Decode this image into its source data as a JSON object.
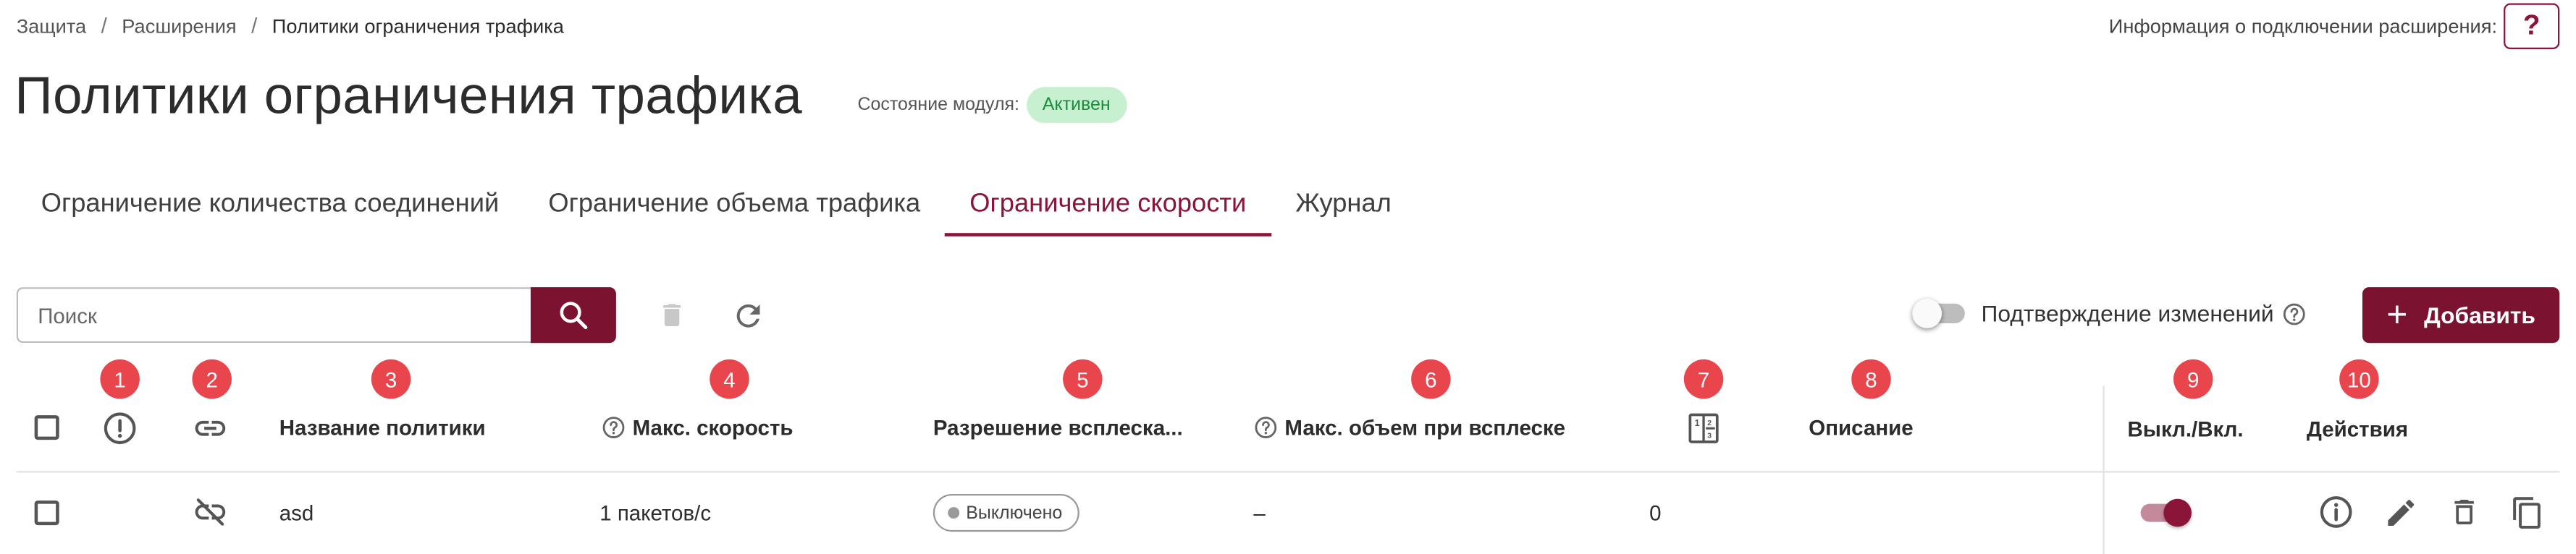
{
  "breadcrumb": {
    "items": [
      "Защита",
      "Расширения"
    ],
    "current": "Политики ограничения трафика",
    "separator": "/"
  },
  "header": {
    "connection_info_label": "Информация о подключении расширения:",
    "help_label": "?",
    "title": "Политики ограничения трафика",
    "module_state_label": "Состояние модуля:",
    "module_state_value": "Активен"
  },
  "tabs": [
    {
      "label": "Ограничение количества соединений",
      "active": false
    },
    {
      "label": "Ограничение объема трафика",
      "active": false
    },
    {
      "label": "Ограничение скорости",
      "active": true
    },
    {
      "label": "Журнал",
      "active": false
    }
  ],
  "toolbar": {
    "search_placeholder": "Поиск",
    "search_value": "",
    "confirm_changes_label": "Подтверждение изменений",
    "confirm_changes_enabled": false,
    "add_label": "Добавить"
  },
  "table": {
    "markers": [
      "1",
      "2",
      "3",
      "4",
      "5",
      "6",
      "7",
      "8",
      "9",
      "10"
    ],
    "columns": {
      "name": "Название политики",
      "max_speed": "Макс. скорость",
      "burst": "Разрешение всплеска...",
      "burst_max": "Макс. объем при всплеске",
      "description": "Описание",
      "enabled": "Выкл./Вкл.",
      "actions": "Действия"
    },
    "rows": [
      {
        "name": "asd",
        "max_speed": "1 пакетов/с",
        "burst": "Выключено",
        "burst_max": "–",
        "counter": "0",
        "description": "",
        "enabled": true
      }
    ]
  },
  "colors": {
    "accent": "#7a1230",
    "marker": "#e8464c",
    "status_active_bg": "#c6f0cf",
    "status_active_text": "#1c8b3d"
  },
  "icons": {
    "search": "search-icon",
    "delete": "trash-icon",
    "refresh": "refresh-icon",
    "help": "help-circle-icon",
    "add": "plus-icon",
    "alert": "alert-circle-icon",
    "link": "link-icon",
    "link_off": "link-off-icon",
    "counter": "counter-column-icon",
    "info": "info-icon",
    "edit": "pencil-icon",
    "copy": "copy-icon"
  }
}
